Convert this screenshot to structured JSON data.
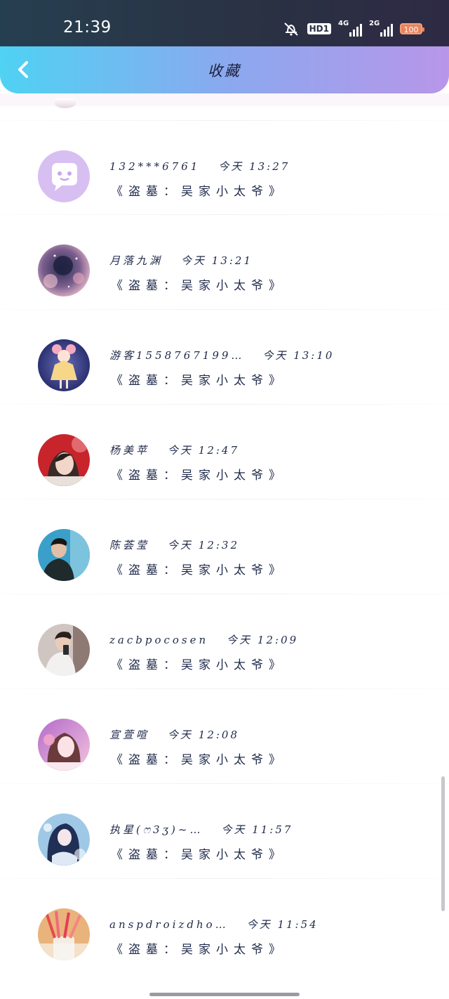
{
  "status_bar": {
    "time": "21:39",
    "hd_badge": "HD1",
    "net1": "4G",
    "net2": "2G",
    "battery": "100"
  },
  "header": {
    "title": "收藏",
    "back_icon": "chevron-left-icon"
  },
  "items": [
    {
      "name": "132***6761",
      "date": "今天 13:27",
      "title": "《盗墓：吴家小太爷》",
      "avatar": "chat-bubble-icon"
    },
    {
      "name": "月落九渊",
      "date": "今天 13:21",
      "title": "《盗墓：吴家小太爷》",
      "avatar": "galaxy-avatar"
    },
    {
      "name": "游客1558767199…",
      "date": "今天 13:10",
      "title": "《盗墓：吴家小太爷》",
      "avatar": "anime-girl-avatar"
    },
    {
      "name": "杨美苹",
      "date": "今天 12:47",
      "title": "《盗墓：吴家小太爷》",
      "avatar": "girl-photo-avatar"
    },
    {
      "name": "陈荟莹",
      "date": "今天 12:32",
      "title": "《盗墓：吴家小太爷》",
      "avatar": "boy-photo-avatar"
    },
    {
      "name": "zacbpocosen",
      "date": "今天 12:09",
      "title": "《盗墓：吴家小太爷》",
      "avatar": "selfie-avatar"
    },
    {
      "name": "宣萱喧",
      "date": "今天 12:08",
      "title": "《盗墓：吴家小太爷》",
      "avatar": "pink-girl-avatar"
    },
    {
      "name": "执星(ෆ3ʒ)~…",
      "date": "今天 11:57",
      "title": "《盗墓：吴家小太爷》",
      "avatar": "blue-anime-avatar"
    },
    {
      "name": "anspdroizdho…",
      "date": "今天 11:54",
      "title": "《盗墓：吴家小太爷》",
      "avatar": "pencils-avatar"
    }
  ]
}
